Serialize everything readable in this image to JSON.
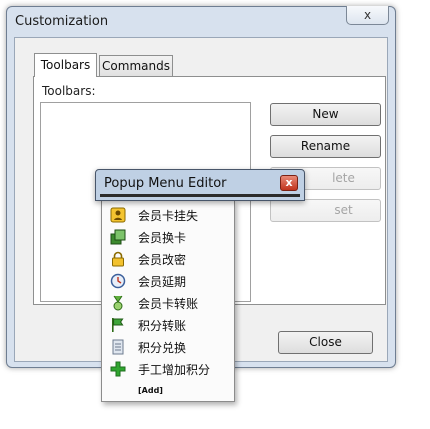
{
  "dialog": {
    "title": "Customization",
    "close_glyph": "x",
    "tabs": [
      {
        "label": "Toolbars",
        "active": true
      },
      {
        "label": "Commands",
        "active": false
      }
    ],
    "toolbars_label": "Toolbars:",
    "buttons": {
      "new": "New",
      "rename": "Rename",
      "delete_partial": "lete",
      "reset_partial": "set"
    },
    "close_button": "Close"
  },
  "popup_editor": {
    "title": "Popup Menu Editor",
    "close_glyph": "x"
  },
  "menu": {
    "items": [
      {
        "label": "会员卡挂失",
        "icon": "member-card-lost-icon"
      },
      {
        "label": "会员换卡",
        "icon": "member-card-swap-icon"
      },
      {
        "label": "会员改密",
        "icon": "padlock-icon"
      },
      {
        "label": "会员延期",
        "icon": "clock-icon"
      },
      {
        "label": "会员卡转账",
        "icon": "ribbon-medal-icon"
      },
      {
        "label": "积分转账",
        "icon": "flag-icon"
      },
      {
        "label": "积分兑换",
        "icon": "document-icon"
      },
      {
        "label": "手工增加积分",
        "icon": "plus-icon"
      }
    ],
    "add_label": "[Add]"
  },
  "colors": {
    "dialog_frame": "#d7e1ee",
    "popup_title_bar": "#bfd0e4",
    "close_red": "#c0331d",
    "plus_green": "#2fa52f"
  }
}
